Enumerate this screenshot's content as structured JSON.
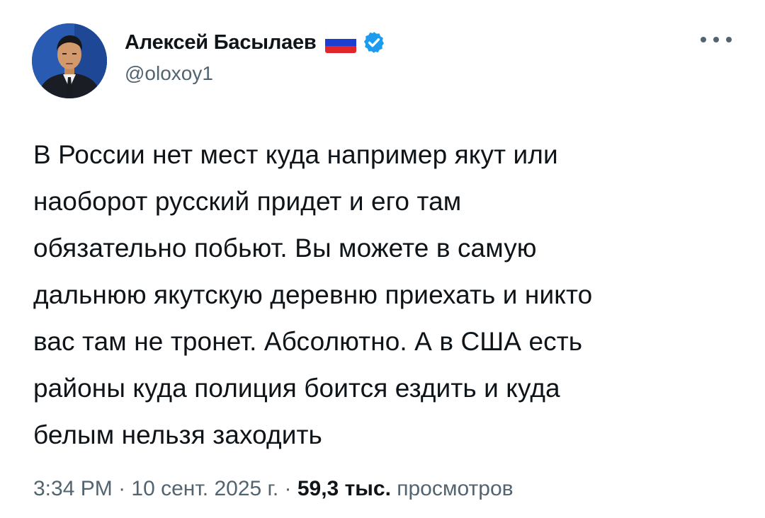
{
  "author": {
    "name": "Алексей Басылаев",
    "handle": "@oloxoy1",
    "flag_colors": [
      "#ffffff",
      "#1c3fd1",
      "#e0262a"
    ],
    "verified_color": "#1d9bf0",
    "avatar_icon": "avatar-photo"
  },
  "menu": {
    "icon": "more-horizontal-icon"
  },
  "tweet": {
    "lines": [
      "В России нет мест куда например якут или",
      "наоборот русский придет и его там",
      "обязательно побьют. Вы можете в самую",
      "дальнюю якутскую деревню приехать и никто",
      "вас там не тронет. Абсолютно. А в США есть",
      "районы куда полиция боится ездить и куда",
      "белым нельзя заходить"
    ]
  },
  "meta": {
    "time": "3:34 PM",
    "separator": "·",
    "date": "10 сент. 2025 г.",
    "views_count": "59,3 тыс.",
    "views_label": "просмотров"
  }
}
